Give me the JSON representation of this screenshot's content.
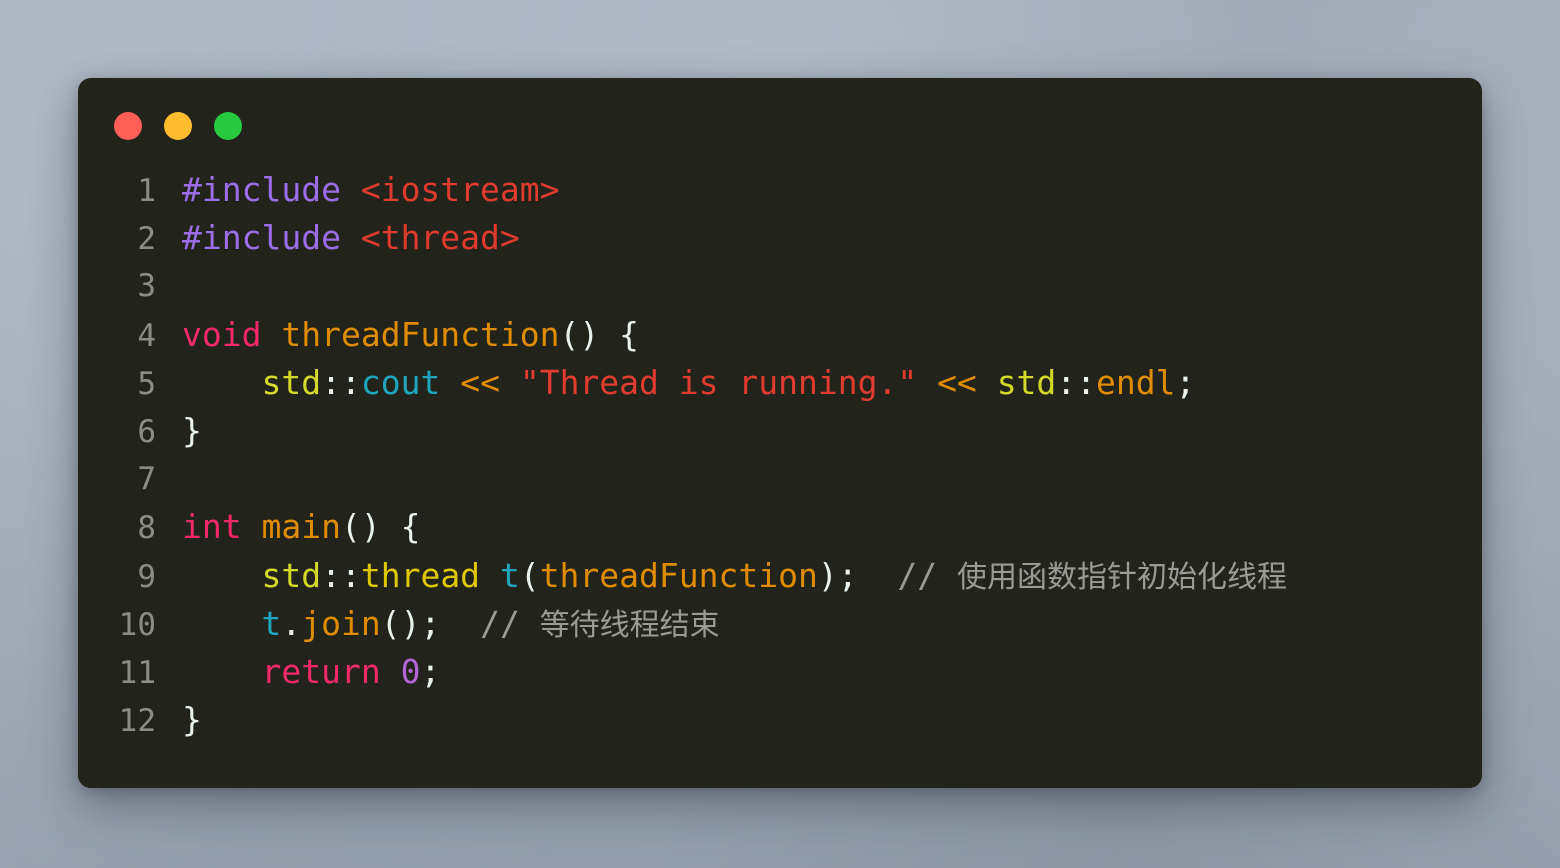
{
  "window": {
    "traffic_lights": [
      {
        "name": "close",
        "color": "#ff5f56"
      },
      {
        "name": "minimize",
        "color": "#ffbd2e"
      },
      {
        "name": "maximize",
        "color": "#27c93f"
      }
    ]
  },
  "editor": {
    "language": "cpp",
    "background": "#22241c",
    "lines": [
      {
        "number": "1",
        "text": "#include <iostream>",
        "tokens": [
          {
            "t": "#include",
            "c": "t-pre"
          },
          {
            "t": " ",
            "c": "t-punc"
          },
          {
            "t": "<iostream>",
            "c": "t-header"
          }
        ]
      },
      {
        "number": "2",
        "text": "#include <thread>",
        "tokens": [
          {
            "t": "#include",
            "c": "t-pre"
          },
          {
            "t": " ",
            "c": "t-punc"
          },
          {
            "t": "<thread>",
            "c": "t-header"
          }
        ]
      },
      {
        "number": "3",
        "text": "",
        "tokens": []
      },
      {
        "number": "4",
        "text": "void threadFunction() {",
        "tokens": [
          {
            "t": "void",
            "c": "t-kw"
          },
          {
            "t": " ",
            "c": "t-punc"
          },
          {
            "t": "threadFunction",
            "c": "t-fn"
          },
          {
            "t": "() {",
            "c": "t-punc"
          }
        ]
      },
      {
        "number": "5",
        "text": "    std::cout << \"Thread is running.\" << std::endl;",
        "tokens": [
          {
            "t": "    ",
            "c": "t-punc"
          },
          {
            "t": "std",
            "c": "t-ns"
          },
          {
            "t": "::",
            "c": "t-punc"
          },
          {
            "t": "cout",
            "c": "t-member"
          },
          {
            "t": " ",
            "c": "t-punc"
          },
          {
            "t": "<<",
            "c": "t-op"
          },
          {
            "t": " ",
            "c": "t-punc"
          },
          {
            "t": "\"Thread is running.\"",
            "c": "t-str"
          },
          {
            "t": " ",
            "c": "t-punc"
          },
          {
            "t": "<<",
            "c": "t-op"
          },
          {
            "t": " ",
            "c": "t-punc"
          },
          {
            "t": "std",
            "c": "t-ns"
          },
          {
            "t": "::",
            "c": "t-punc"
          },
          {
            "t": "endl",
            "c": "t-fn"
          },
          {
            "t": ";",
            "c": "t-punc"
          }
        ]
      },
      {
        "number": "6",
        "text": "}",
        "tokens": [
          {
            "t": "}",
            "c": "t-punc"
          }
        ]
      },
      {
        "number": "7",
        "text": "",
        "tokens": []
      },
      {
        "number": "8",
        "text": "int main() {",
        "tokens": [
          {
            "t": "int",
            "c": "t-kw"
          },
          {
            "t": " ",
            "c": "t-punc"
          },
          {
            "t": "main",
            "c": "t-fn"
          },
          {
            "t": "() {",
            "c": "t-punc"
          }
        ]
      },
      {
        "number": "9",
        "text": "    std::thread t(threadFunction);  // 使用函数指针初始化线程",
        "tokens": [
          {
            "t": "    ",
            "c": "t-punc"
          },
          {
            "t": "std",
            "c": "t-ns"
          },
          {
            "t": "::",
            "c": "t-punc"
          },
          {
            "t": "thread",
            "c": "t-type"
          },
          {
            "t": " ",
            "c": "t-punc"
          },
          {
            "t": "t",
            "c": "t-member"
          },
          {
            "t": "(",
            "c": "t-punc"
          },
          {
            "t": "threadFunction",
            "c": "t-fn"
          },
          {
            "t": ");",
            "c": "t-punc"
          },
          {
            "t": "  ",
            "c": "t-punc"
          },
          {
            "t": "// ",
            "c": "t-comment"
          },
          {
            "t": "使用函数指针初始化线程",
            "c": "t-comment t-cjk"
          }
        ]
      },
      {
        "number": "10",
        "text": "    t.join();  // 等待线程结束",
        "tokens": [
          {
            "t": "    ",
            "c": "t-punc"
          },
          {
            "t": "t",
            "c": "t-member"
          },
          {
            "t": ".",
            "c": "t-punc"
          },
          {
            "t": "join",
            "c": "t-fn"
          },
          {
            "t": "();",
            "c": "t-punc"
          },
          {
            "t": "  ",
            "c": "t-punc"
          },
          {
            "t": "// ",
            "c": "t-comment"
          },
          {
            "t": "等待线程结束",
            "c": "t-comment t-cjk"
          }
        ]
      },
      {
        "number": "11",
        "text": "    return 0;",
        "tokens": [
          {
            "t": "    ",
            "c": "t-punc"
          },
          {
            "t": "return",
            "c": "t-kw"
          },
          {
            "t": " ",
            "c": "t-punc"
          },
          {
            "t": "0",
            "c": "t-num"
          },
          {
            "t": ";",
            "c": "t-punc"
          }
        ]
      },
      {
        "number": "12",
        "text": "}",
        "tokens": [
          {
            "t": "}",
            "c": "t-punc"
          }
        ]
      }
    ]
  }
}
